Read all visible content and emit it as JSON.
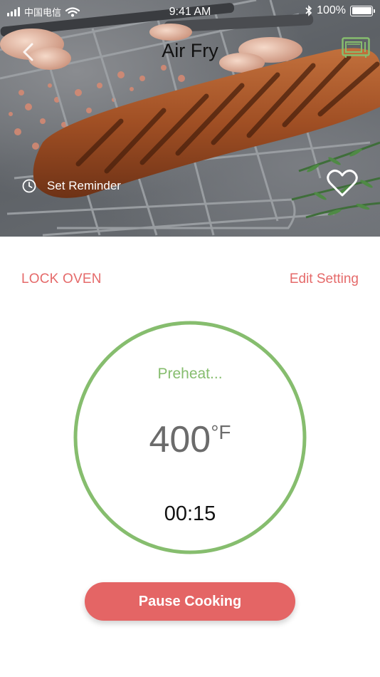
{
  "status_bar": {
    "carrier": "中国电信",
    "time": "9:41 AM",
    "battery": "100%",
    "battery_level": 1.0
  },
  "header": {
    "title": "Air Fry"
  },
  "hero": {
    "reminder_label": "Set Reminder"
  },
  "controls": {
    "lock_label": "LOCK OVEN",
    "edit_label": "Edit Setting"
  },
  "dial": {
    "status": "Preheat...",
    "temperature": "400",
    "unit": "°F",
    "timer": "00:15",
    "ring_color": "#86bd6e"
  },
  "actions": {
    "pause_label": "Pause Cooking"
  },
  "colors": {
    "accent_red": "#e46565",
    "accent_green": "#86bd6e"
  },
  "icons": [
    "signal-icon",
    "wifi-icon",
    "bluetooth-icon",
    "battery-icon",
    "back-arrow-icon",
    "oven-icon",
    "clock-icon",
    "heart-icon"
  ]
}
